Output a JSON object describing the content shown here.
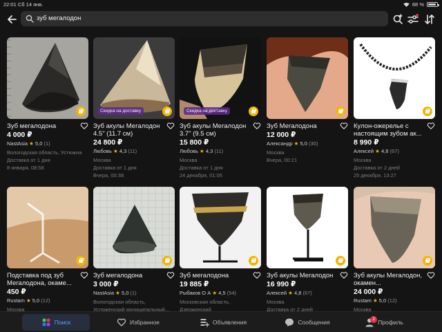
{
  "status_bar": {
    "left": "22:01  Сб 14 янв.",
    "battery": "88 %",
    "battery_level": 0.88
  },
  "search": {
    "query": "зуб мегалодон"
  },
  "delivery_badge": "Скидка на доставку",
  "listings": [
    {
      "title": "Зуб мегалодона",
      "price": "4 000 ₽",
      "seller": "NastAsia",
      "rating": "5,0",
      "reviews": "(1)",
      "meta": [
        "Вологодская область, Устюжна",
        "Доставка от 1 дня",
        "8 января, 08:58"
      ],
      "delivery_badge": false
    },
    {
      "title": "Зуб акулы Мегалодон 4.5\" (11.7 см)",
      "price": "24 800 ₽",
      "seller": "Любовь",
      "rating": "4,3",
      "reviews": "(11)",
      "meta": [
        "Москва",
        "Доставка от 1 дня",
        "Вчера, 00:38"
      ],
      "delivery_badge": true
    },
    {
      "title": "Зуб акулы Мегалодон 3.7\" (9.5 см)",
      "price": "15 800 ₽",
      "seller": "Любовь",
      "rating": "4,3",
      "reviews": "(11)",
      "meta": [
        "Москва",
        "Доставка от 1 дня",
        "24 декабря, 01:05"
      ],
      "delivery_badge": true
    },
    {
      "title": "Зуб Мегалодона",
      "price": "12 000 ₽",
      "seller": "Александр",
      "rating": "5,0",
      "reviews": "(30)",
      "meta": [
        "Москва",
        "Вчера, 00:21"
      ],
      "delivery_badge": false
    },
    {
      "title": "Кулон-ожерелье с настоящим зубом ак...",
      "price": "8 990 ₽",
      "seller": "Алексей",
      "rating": "4,8",
      "reviews": "(67)",
      "meta": [
        "Москва",
        "Доставка от 2 дней",
        "25 декабря, 13:27"
      ],
      "delivery_badge": false
    },
    {
      "title": "Подставка под зуб Мегалодона, окаме...",
      "price": "450 ₽",
      "seller": "Rustam",
      "rating": "5,0",
      "reviews": "(12)",
      "meta": [
        "Москва"
      ],
      "delivery_badge": false
    },
    {
      "title": "Зуб мегалодона",
      "price": "3 000 ₽",
      "seller": "NastAsia",
      "rating": "5,0",
      "reviews": "(1)",
      "meta": [
        "Вологодская область,",
        "Устюженский муниципальный..."
      ],
      "delivery_badge": false
    },
    {
      "title": "Зуб мегалодона",
      "price": "19 885 ₽",
      "seller": "Рыбаков О А",
      "rating": "4,5",
      "reviews": "(54)",
      "meta": [
        "Московская область,",
        "Дзержинский"
      ],
      "delivery_badge": false
    },
    {
      "title": "Зуб акулы Мегалодон",
      "price": "16 990 ₽",
      "seller": "Алексей",
      "rating": "4,8",
      "reviews": "(67)",
      "meta": [
        "Москва",
        "Доставка от 2 дней"
      ],
      "delivery_badge": false
    },
    {
      "title": "Зуб акулы Мегалодон, окамен...",
      "price": "24 000 ₽",
      "seller": "Rustam",
      "rating": "5,0",
      "reviews": "(12)",
      "meta": [
        "Москва"
      ],
      "delivery_badge": false
    }
  ],
  "nav": {
    "search": "Поиск",
    "favorites": "Избранное",
    "ads": "Объявления",
    "messages": "Сообщения",
    "profile": "Профиль",
    "profile_badge": "2"
  },
  "colors": {
    "background": "#141414",
    "accent": "#5aa2ff",
    "star": "#f5b400",
    "notification": "#e2334a"
  }
}
